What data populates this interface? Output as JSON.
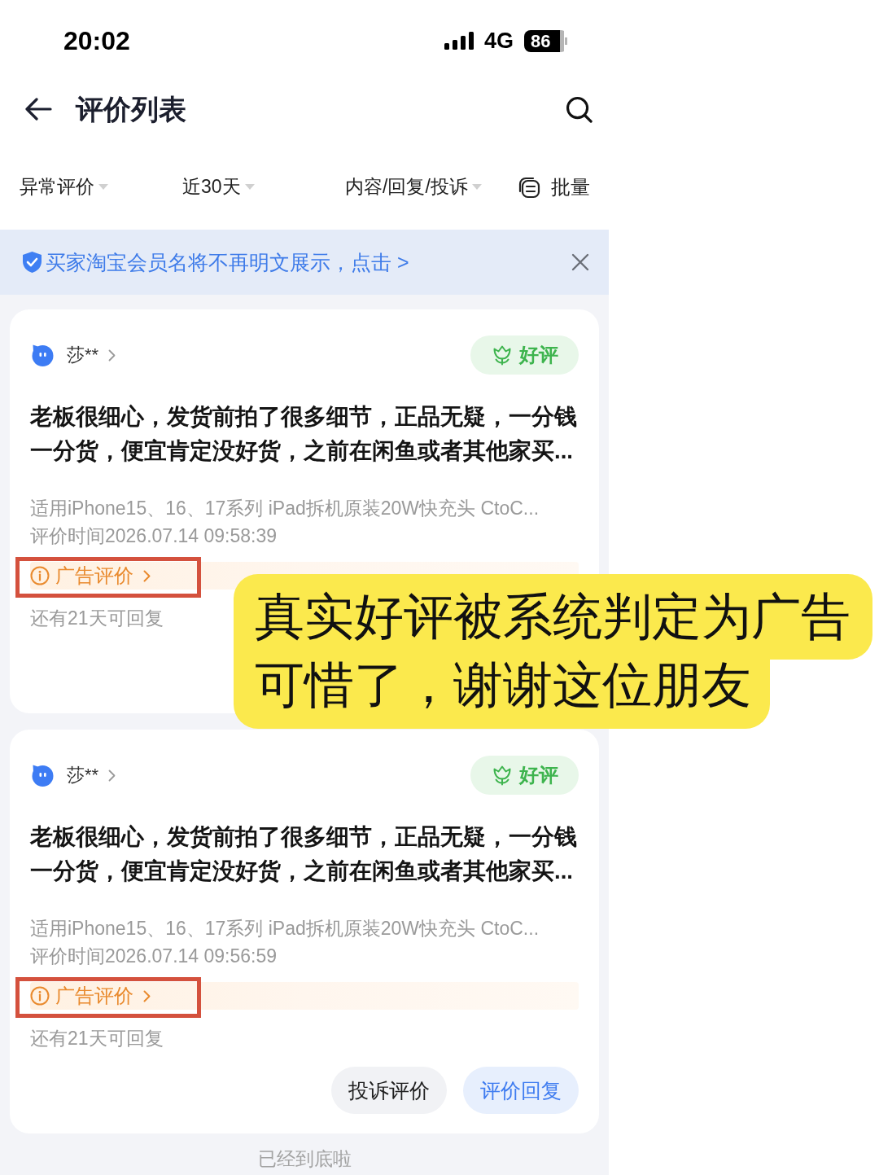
{
  "status_bar": {
    "time": "20:02",
    "network": "4G",
    "battery": "86"
  },
  "header": {
    "title": "评价列表"
  },
  "filters": [
    {
      "label": "异常评价",
      "kind": "dropdown"
    },
    {
      "label": "近30天",
      "kind": "dropdown"
    },
    {
      "label": "内容/回复/投诉",
      "kind": "dropdown"
    },
    {
      "label": "批量",
      "kind": "batch"
    }
  ],
  "notice": {
    "text": "买家淘宝会员名将不再明文展示，",
    "link": "点击 >"
  },
  "reviews": [
    {
      "user": "莎**",
      "rating": "好评",
      "content": "老板很细心，发货前拍了很多细节，正品无疑，一分钱一分货，便宜肯定没好货，之前在闲鱼或者其他家买...",
      "product": "适用iPhone15、16、17系列 iPad拆机原装20W快充头 CtoC...",
      "time": "评价时间2026.07.14 09:58:39",
      "tag": "广告评价",
      "tag_highlighted": true,
      "reply_note": "还有21天可回复"
    },
    {
      "user": "莎**",
      "rating": "好评",
      "content": "老板很细心，发货前拍了很多细节，正品无疑，一分钱一分货，便宜肯定没好货，之前在闲鱼或者其他家买...",
      "product": "适用iPhone15、16、17系列 iPad拆机原装20W快充头 CtoC...",
      "time": "评价时间2026.07.14 09:56:59",
      "tag": "广告评价",
      "tag_highlighted": true,
      "reply_note": "还有21天可回复",
      "actions": [
        {
          "label": "投诉评价",
          "kind": "secondary"
        },
        {
          "label": "评价回复",
          "kind": "primary"
        }
      ]
    }
  ],
  "footer": {
    "text": "已经到底啦"
  },
  "annotation": {
    "lines": [
      "真实好评被系统判定为广告",
      "可惜了，谢谢这位朋友"
    ]
  }
}
